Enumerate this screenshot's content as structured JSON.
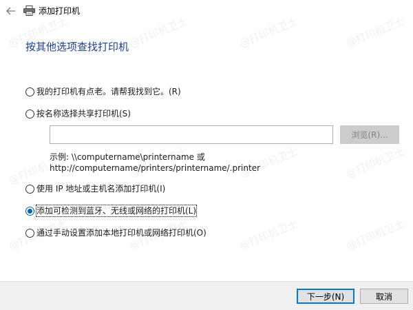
{
  "window": {
    "title": "添加打印机"
  },
  "heading": "按其他选项查找打印机",
  "options": [
    {
      "label": "我的打印机有点老。请帮我找到它。(R)",
      "checked": false
    },
    {
      "label": "按名称选择共享打印机(S)",
      "checked": false
    },
    {
      "label": "使用 IP 地址或主机名添加打印机(I)",
      "checked": false
    },
    {
      "label": "添加可检测到蓝牙、无线或网络的打印机(L)",
      "checked": true
    },
    {
      "label": "通过手动设置添加本地打印机或网络打印机(O)",
      "checked": false
    }
  ],
  "share": {
    "input_value": "",
    "browse_label": "浏览(R)...",
    "example_line1": "示例: \\\\computername\\printername 或",
    "example_line2": "http://computername/printers/printername/.printer"
  },
  "buttons": {
    "next": "下一步(N)",
    "cancel": "取消"
  },
  "watermark": "@打印机卫士",
  "colors": {
    "heading": "#1a3f99",
    "accent": "#0078d7",
    "footer_bg": "#f0f0f0"
  },
  "icons": {
    "back": "back-arrow-icon",
    "printer": "printer-icon"
  }
}
